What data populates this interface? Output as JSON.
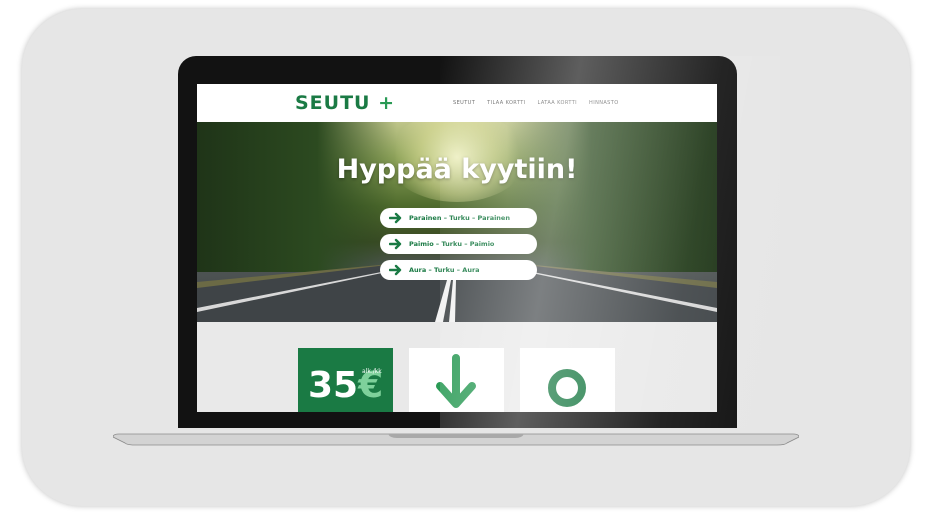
{
  "site": {
    "logo_text": "SEUTU",
    "logo_plus": "+",
    "nav_links": [
      "SEUTUT",
      "TILAA KORTTI",
      "LATAA KORTTI",
      "HINNASTO"
    ]
  },
  "hero": {
    "title": "Hyppää kyytiin!",
    "routes": [
      {
        "label": "Parainen – Turku – Parainen"
      },
      {
        "label": "Paimio – Turku – Paimio"
      },
      {
        "label": "Aura – Turku – Aura"
      }
    ]
  },
  "tiles": {
    "price_value": "35",
    "price_currency": "€",
    "price_unit": "alk./kk",
    "download_icon": "arrow-down-icon",
    "ring_icon": "ring-icon"
  },
  "colors": {
    "brand_green": "#1a7a44",
    "accent_green": "#2a9a55",
    "light_green": "#7ed19b"
  }
}
